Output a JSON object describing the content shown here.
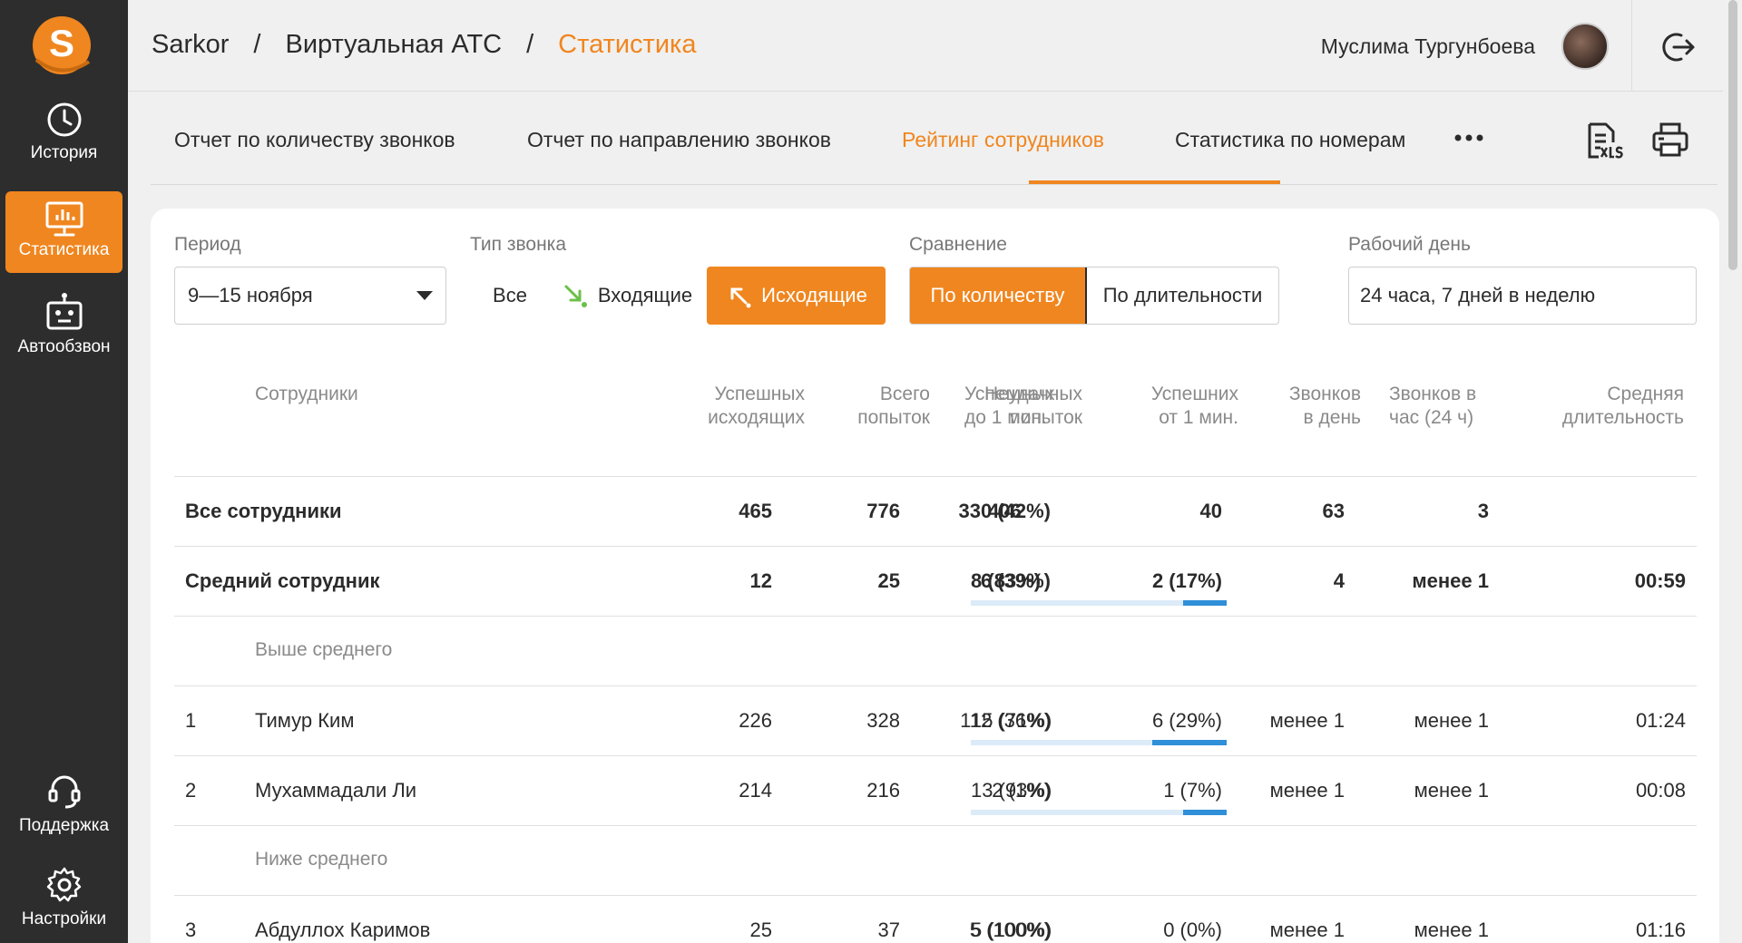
{
  "sidebar": {
    "logo_letter": "S",
    "items": [
      {
        "label": "История",
        "icon": "clock-icon"
      },
      {
        "label": "Статистика",
        "icon": "monitor-chart-icon",
        "active": true
      },
      {
        "label": "Автообзвон",
        "icon": "robot-icon"
      },
      {
        "label": "Поддержка",
        "icon": "headset-icon"
      },
      {
        "label": "Настройки",
        "icon": "gear-icon"
      }
    ]
  },
  "header": {
    "breadcrumb": [
      "Sarkor",
      "Виртуальная АТС",
      "Статистика"
    ],
    "separator": "/",
    "user_name": "Муслима Тургунбоева"
  },
  "tabs": [
    {
      "label": "Отчет по количеству звонков"
    },
    {
      "label": "Отчет по направлению звонков"
    },
    {
      "label": "Рейтинг сотрудников",
      "active": true
    },
    {
      "label": "Статистика по номерам"
    }
  ],
  "filters": {
    "period": {
      "label": "Период",
      "value": "9—15 ноября"
    },
    "call_type": {
      "label": "Тип звонка",
      "options": [
        "Все",
        "Входящие",
        "Исходящие"
      ],
      "selected": "Исходящие"
    },
    "comparison": {
      "label": "Сравнение",
      "options": [
        "По количеству",
        "По длительности"
      ],
      "selected": "По количеству"
    },
    "workday": {
      "label": "Рабочий день",
      "value": "24 часа, 7 дней в неделю"
    }
  },
  "table": {
    "columns": [
      [
        "Сотрудники"
      ],
      [
        "Успешных",
        "исходящих"
      ],
      [
        "Всего",
        "попыток"
      ],
      [
        "Неудачных",
        "попыток"
      ],
      [
        "Успешных",
        "до 1 мин."
      ],
      [
        "Успешних",
        "от 1 мин."
      ],
      [
        "Звонков",
        "в день"
      ],
      [
        "Звонков в",
        "час (24 ч)"
      ],
      [
        "Средняя",
        "длительность"
      ]
    ],
    "all": {
      "name": "Все сотрудники",
      "success": "465",
      "total": "776",
      "failed": "330 (42%)",
      "under1": "406",
      "over1": "40",
      "per_day": "63",
      "per_hour": "3",
      "avg": ""
    },
    "average": {
      "name": "Средний сотрудник",
      "success": "12",
      "total": "25",
      "failed": "6 (39%)",
      "under1": "8 (83%)",
      "over1": "2 (17%)",
      "over1_share": 0.17,
      "per_day": "4",
      "per_hour": "менее 1",
      "avg": "00:59"
    },
    "above_label": "Выше среднего",
    "below_label": "Ниже среднего",
    "rows": [
      {
        "rank": "1",
        "name": "Тимур Ким",
        "success": "226",
        "total": "328",
        "failed": "112 (36%)",
        "under1": "15 (71%)",
        "over1": "6 (29%)",
        "over1_share": 0.29,
        "per_day": "менее 1",
        "per_hour": "менее 1",
        "avg": "01:24"
      },
      {
        "rank": "2",
        "name": "Мухаммадали Ли",
        "success": "214",
        "total": "216",
        "failed": "2 (1%)",
        "under1": "13 (93%)",
        "over1": "1 (7%)",
        "over1_share": 0.17,
        "per_day": "менее 1",
        "per_hour": "менее 1",
        "avg": "00:08"
      },
      {
        "rank": "3",
        "name": "Абдуллох Каримов",
        "success": "25",
        "total": "37",
        "failed": "5 (100%)",
        "under1": "5 (100%)",
        "over1": "0 (0%)",
        "over1_share": 0,
        "per_day": "менее 1",
        "per_hour": "менее 1",
        "avg": "01:16"
      }
    ]
  },
  "colors": {
    "accent": "#f0861f",
    "sidebar": "#2d2d2d",
    "bar": "#2f8fd8",
    "bar_track": "#dcebf8"
  }
}
